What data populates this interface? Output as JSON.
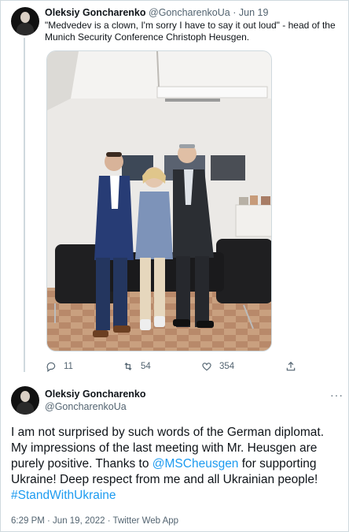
{
  "tweet1": {
    "author_name": "Oleksiy Goncharenko",
    "handle": "@GoncharenkoUa",
    "separator": "·",
    "date": "Jun 19",
    "text": "\"Medvedev is a clown, I'm sorry I have to say it out loud\" - head of the Munich Security Conference Christoph Heusgen.",
    "image_icon": "photo-of-three-people-in-office",
    "actions": {
      "reply_count": "11",
      "retweet_count": "54",
      "like_count": "354"
    }
  },
  "tweet2": {
    "author_name": "Oleksiy Goncharenko",
    "handle": "@GoncharenkoUa",
    "more_label": "···",
    "text_part1": "I am not surprised by such words of the German diplomat. My impressions of the last meeting with Mr. Heusgen are purely positive. Thanks to ",
    "mention": "@MSCheusgen",
    "text_part2": " for supporting Ukraine! Deep respect from me and all Ukrainian people! ",
    "hashtag": "#StandWithUkraine",
    "meta": "6:29 PM · Jun 19, 2022 · Twitter Web App"
  },
  "colors": {
    "link": "#1d9bf0",
    "muted": "#536471",
    "text": "#0f1419",
    "border": "#cfd9de"
  }
}
